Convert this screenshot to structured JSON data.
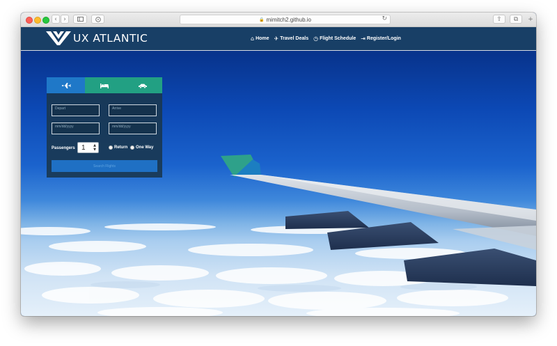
{
  "browser": {
    "url": "mimitch2.github.io",
    "back_glyph": "‹",
    "forward_glyph": "›",
    "reload_glyph": "↻",
    "share_glyph": "⇧",
    "tabs_glyph": "⧉",
    "new_tab_glyph": "+"
  },
  "site": {
    "brand": "UX ATLANTIC",
    "nav": [
      {
        "label": "Home",
        "icon": "home-icon",
        "glyph": "⌂"
      },
      {
        "label": "Travel Deals",
        "icon": "plane-icon",
        "glyph": "✈"
      },
      {
        "label": "Flight Schedule",
        "icon": "clock-icon",
        "glyph": "◷"
      },
      {
        "label": "Register/Login",
        "icon": "login-icon",
        "glyph": "⇥"
      }
    ]
  },
  "search": {
    "tabs": [
      {
        "name": "flights",
        "icon": "plane-icon",
        "color": "#1f78c8"
      },
      {
        "name": "hotels",
        "icon": "bed-icon",
        "color": "#22a083"
      },
      {
        "name": "cars",
        "icon": "car-icon",
        "color": "#22a083"
      }
    ],
    "from_placeholder": "Depart",
    "to_placeholder": "Arrive",
    "depart_date_placeholder": "mm/dd/yyyy",
    "return_date_placeholder": "mm/dd/yyyy",
    "passengers_label": "Passengers",
    "passengers_value": "1",
    "trip_options": [
      "Return",
      "One Way"
    ],
    "button_label": "Search Flights"
  },
  "colors": {
    "navbar": "#183f66",
    "tab_active": "#1f78c8",
    "tab_inactive": "#22a083",
    "button": "#1f70c4"
  }
}
